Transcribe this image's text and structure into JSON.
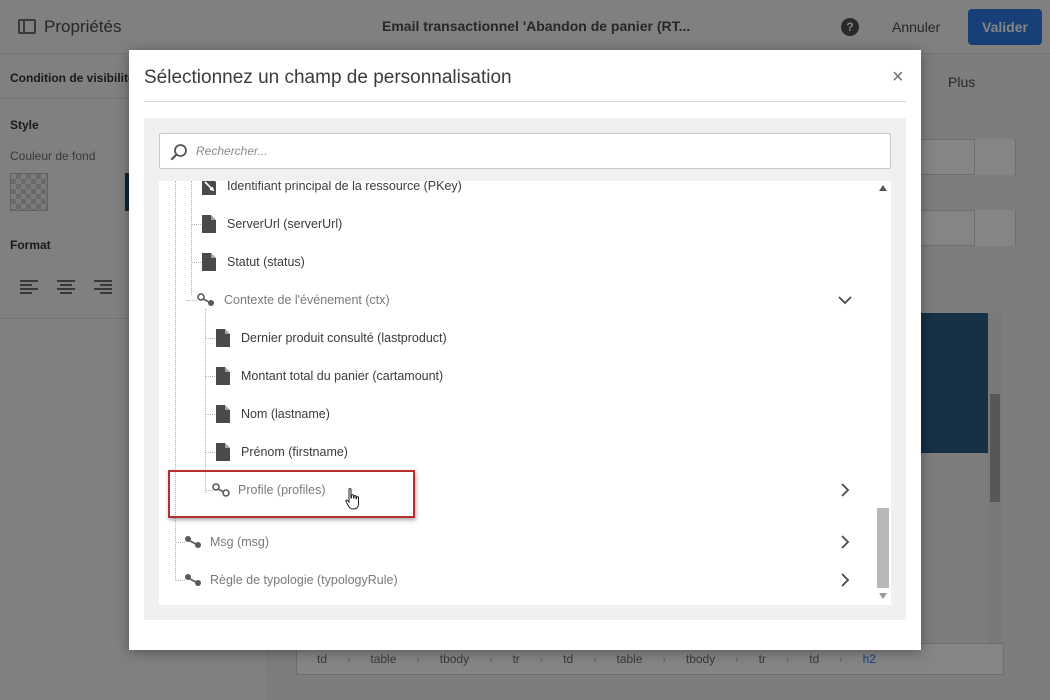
{
  "app": {
    "panel_title": "Propriétés",
    "document_title": "Email transactionnel 'Abandon de panier (RT...",
    "help_label": "?",
    "cancel_label": "Annuler",
    "validate_label": "Valider",
    "sidebar": {
      "visibility_condition": "Condition de visibilité",
      "style_heading": "Style",
      "bg_color_label": "Couleur de fond",
      "format_heading": "Format"
    },
    "more_label": "Plus",
    "breadcrumb": [
      "td",
      "table",
      "tbody",
      "tr",
      "td",
      "table",
      "tbody",
      "tr",
      "td",
      "h2"
    ]
  },
  "modal": {
    "title": "Sélectionnez un champ de personnalisation",
    "close_label": "×",
    "search_placeholder": "Rechercher..."
  },
  "tree": {
    "items": [
      {
        "label": "Identifiant principal de la ressource (PKey)",
        "icon": "key-field-icon",
        "level": 1,
        "type": "field"
      },
      {
        "label": "ServerUrl (serverUrl)",
        "icon": "document-icon",
        "level": 1,
        "type": "field"
      },
      {
        "label": "Statut (status)",
        "icon": "document-icon",
        "level": 1,
        "type": "field"
      },
      {
        "label": "Contexte de l'événement (ctx)",
        "icon": "link-node-icon",
        "level": 1,
        "type": "node",
        "expanded": true
      },
      {
        "label": "Dernier produit consulté (lastproduct)",
        "icon": "document-icon",
        "level": 2,
        "type": "field"
      },
      {
        "label": "Montant total du panier (cartamount)",
        "icon": "document-icon",
        "level": 2,
        "type": "field"
      },
      {
        "label": "Nom (lastname)",
        "icon": "document-icon",
        "level": 2,
        "type": "field"
      },
      {
        "label": "Prénom (firstname)",
        "icon": "document-icon",
        "level": 2,
        "type": "field"
      },
      {
        "label": "Profile (profiles)",
        "icon": "link-node-icon",
        "level": 2,
        "type": "node",
        "expanded": false,
        "highlighted": true
      },
      {
        "label": "Msg (msg)",
        "icon": "link-node-icon",
        "level": 0,
        "type": "node",
        "expanded": false
      },
      {
        "label": "Règle de typologie (typologyRule)",
        "icon": "link-node-icon",
        "level": 0,
        "type": "node",
        "expanded": false
      }
    ]
  },
  "colors": {
    "accent": "#2d7ae6",
    "highlight_border": "#b82d2d",
    "overlay": "rgba(0,0,0,0.48)"
  }
}
